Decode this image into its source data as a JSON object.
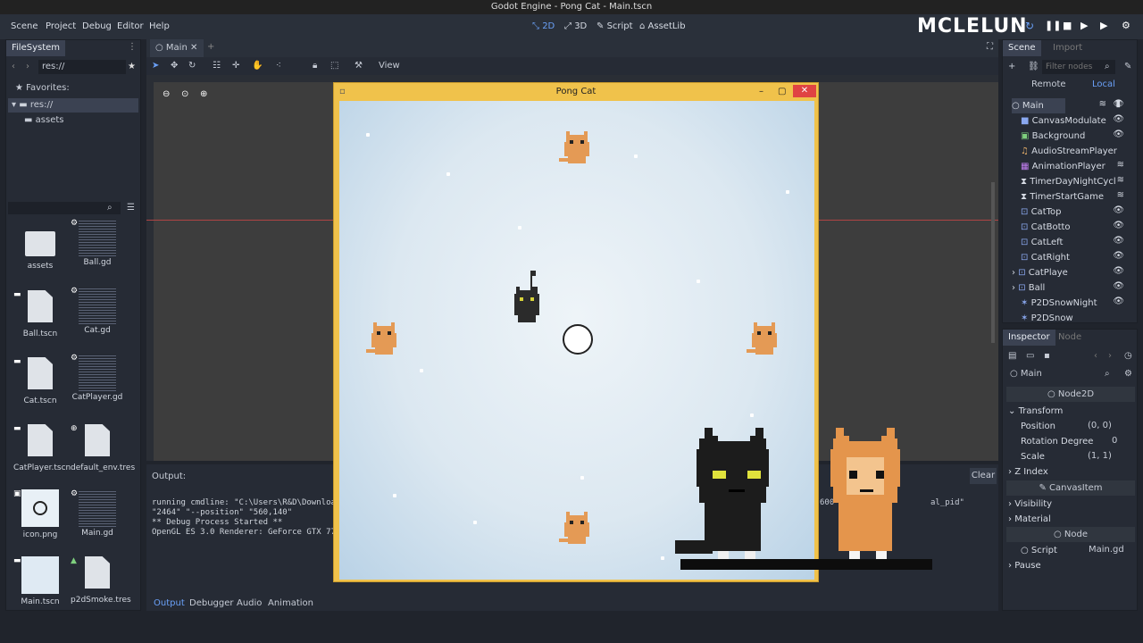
{
  "window_title": "Godot Engine - Pong Cat - Main.tscn",
  "menu": [
    "Scene",
    "Project",
    "Debug",
    "Editor",
    "Help"
  ],
  "workspace": {
    "btn_2d": "2D",
    "btn_3d": "3D",
    "btn_script": "Script",
    "btn_assetlib": "AssetLib"
  },
  "brand": "MCLELUN",
  "filesystem": {
    "tab": "FileSystem",
    "path": "res://",
    "favorites": "Favorites:",
    "root": "res://",
    "folder": "assets",
    "files": [
      "assets",
      "Ball.gd",
      "Ball.tscn",
      "Cat.gd",
      "Cat.tscn",
      "CatPlayer.gd",
      "CatPlayer.tscn",
      "default_env.tres",
      "icon.png",
      "Main.gd",
      "Main.tscn",
      "p2dSmoke.tres"
    ]
  },
  "editor_tab": "Main",
  "toolbar": {
    "view": "View"
  },
  "game_window": {
    "title": "Pong Cat"
  },
  "output": {
    "label": "Output:",
    "clear": "Clear",
    "lines": [
      "running cmdline: \"C:\\Users\\R&D\\Download",
      "\"2464\" \"--position\" \"560,140\"",
      "** Debug Process Started **",
      "OpenGL ES 3.0 Renderer: GeForce GTX 77"
    ],
    "fragment_a": "600",
    "fragment_b": "al_pid\"",
    "tabs": [
      "Output",
      "Debugger",
      "Audio",
      "Animation"
    ]
  },
  "scene": {
    "tab": "Scene",
    "tab2": "Import",
    "filter_placeholder": "Filter nodes",
    "remote": "Remote",
    "local": "Local",
    "nodes": [
      "Main",
      "CanvasModulate",
      "Background",
      "AudioStreamPlayer",
      "AnimationPlayer",
      "TimerDayNightCycl",
      "TimerStartGame",
      "CatTop",
      "CatBotto",
      "CatLeft",
      "CatRight",
      "CatPlaye",
      "Ball",
      "P2DSnowNight",
      "P2DSnow"
    ]
  },
  "inspector": {
    "tab": "Inspector",
    "tab2": "Node",
    "node": "Main",
    "class": "Node2D",
    "section": "Transform",
    "position_label": "Position",
    "position_value": "(0, 0)",
    "rotation_label": "Rotation Degree",
    "rotation_value": "0",
    "scale_label": "Scale",
    "scale_value": "(1, 1)",
    "zindex": "Z Index",
    "canvasitem": "CanvasItem",
    "visibility": "Visibility",
    "material": "Material",
    "node_section": "Node",
    "script_label": "Script",
    "script_value": "Main.gd",
    "pause": "Pause"
  },
  "colors": {
    "accent": "#6aa0f7",
    "window_frame": "#f0c24b",
    "close": "#e04343",
    "snow": "#e4eef6"
  },
  "icons": [
    "folder-icon",
    "document-icon",
    "gear-icon",
    "eye-icon",
    "close-icon",
    "play-icon",
    "pause-icon",
    "stop-icon",
    "search-icon",
    "lock-icon"
  ]
}
